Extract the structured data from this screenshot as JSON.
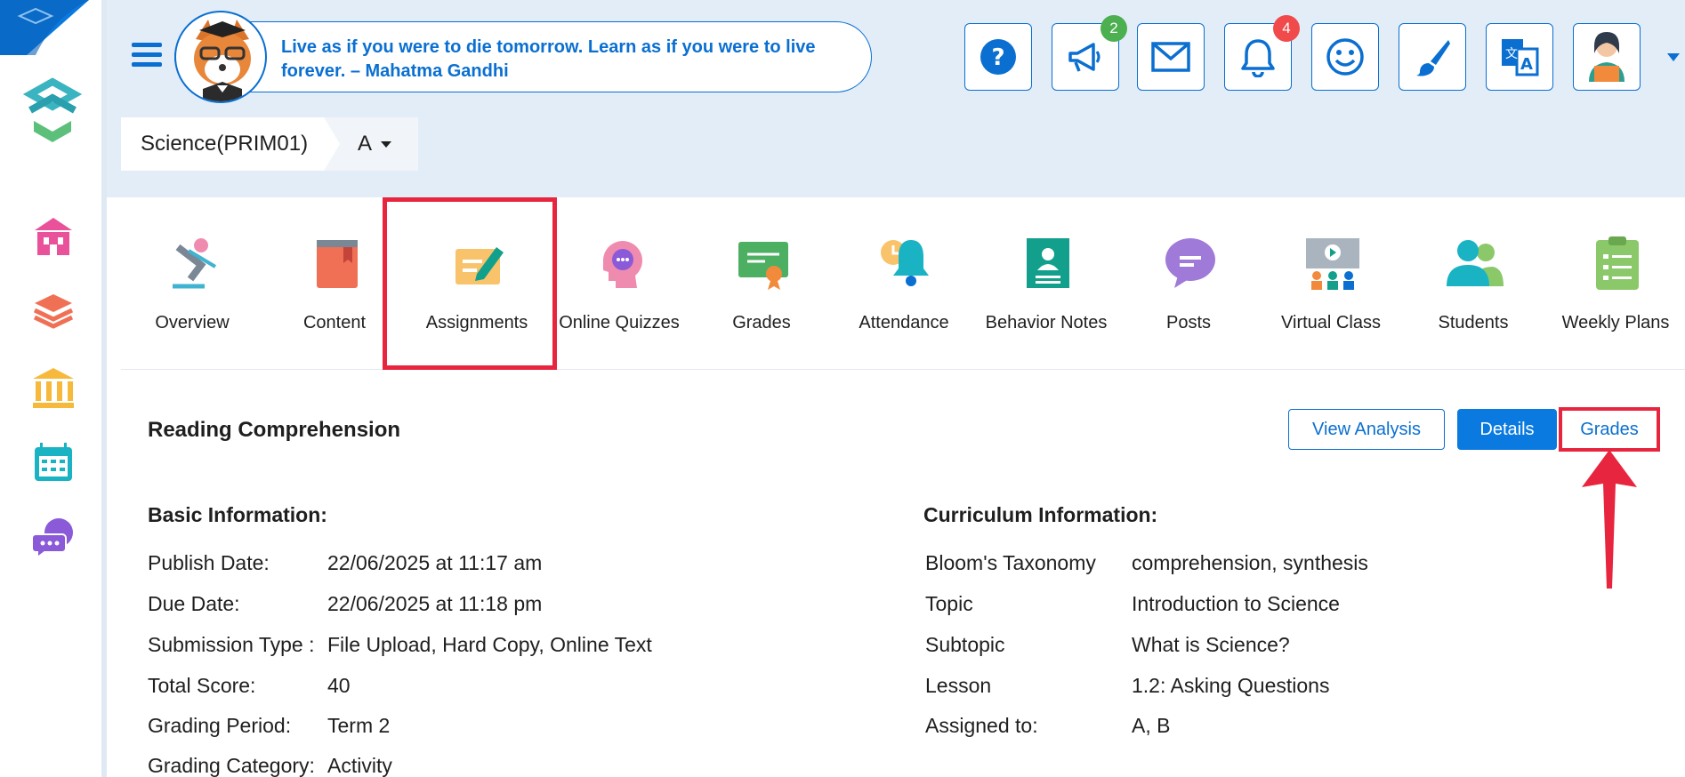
{
  "header": {
    "quote": "Live as if you were to die tomorrow. Learn as if you were to live forever. – Mahatma Gandhi",
    "buttons": [
      {
        "icon": "help-icon"
      },
      {
        "icon": "megaphone-icon",
        "badge": "2",
        "badge_color": "#4caf50"
      },
      {
        "icon": "mail-icon"
      },
      {
        "icon": "bell-icon",
        "badge": "4",
        "badge_color": "#f04a4a"
      },
      {
        "icon": "smiley-icon"
      },
      {
        "icon": "paintbrush-icon"
      },
      {
        "icon": "translate-icon"
      },
      {
        "icon": "user-avatar-icon"
      }
    ]
  },
  "breadcrumb": {
    "subject": "Science(PRIM01)",
    "section": "A"
  },
  "tabs": [
    {
      "label": "Overview"
    },
    {
      "label": "Content"
    },
    {
      "label": "Assignments"
    },
    {
      "label": "Online Quizzes"
    },
    {
      "label": "Grades"
    },
    {
      "label": "Attendance"
    },
    {
      "label": "Behavior Notes"
    },
    {
      "label": "Posts"
    },
    {
      "label": "Virtual Class"
    },
    {
      "label": "Students"
    },
    {
      "label": "Weekly Plans"
    }
  ],
  "page": {
    "title": "Reading Comprehension",
    "view_analysis": "View Analysis",
    "details": "Details",
    "grades": "Grades"
  },
  "basic": {
    "heading": "Basic Information:",
    "rows": [
      {
        "label": "Publish Date:",
        "value": "22/06/2025 at 11:17 am"
      },
      {
        "label": "Due Date:",
        "value": "22/06/2025 at 11:18 pm"
      },
      {
        "label": "Submission Type :",
        "value": "File Upload, Hard Copy, Online Text"
      },
      {
        "label": "Total Score:",
        "value": "40"
      },
      {
        "label": "Grading Period:",
        "value": "Term 2"
      },
      {
        "label": "Grading Category:",
        "value": "Activity"
      }
    ]
  },
  "curriculum": {
    "heading": "Curriculum Information:",
    "rows": [
      {
        "label": "Bloom's Taxonomy",
        "value": "comprehension, synthesis"
      },
      {
        "label": "Topic",
        "value": "Introduction to Science"
      },
      {
        "label": "Subtopic",
        "value": "What is Science?"
      },
      {
        "label": "Lesson",
        "value": "1.2: Asking Questions"
      },
      {
        "label": "Assigned to:",
        "value": "A, B"
      }
    ]
  },
  "colors": {
    "primary": "#0a6fd1",
    "highlight": "#e8253f",
    "band": "#e2edf8"
  }
}
